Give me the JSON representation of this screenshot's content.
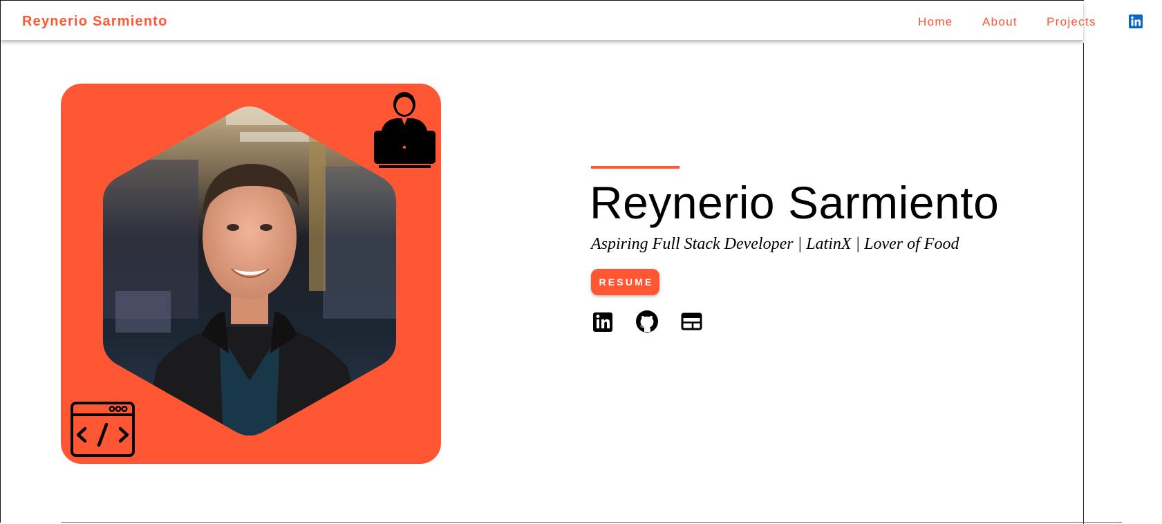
{
  "navbar": {
    "brand": "Reynerio Sarmiento",
    "links": [
      {
        "label": "Home"
      },
      {
        "label": "About"
      },
      {
        "label": "Projects"
      }
    ],
    "social_icon": "linkedin-icon"
  },
  "hero": {
    "name": "Reynerio Sarmiento",
    "tagline": "Aspiring Full Stack Developer | LatinX | Lover of Food",
    "resume_button": "RESUME",
    "social_links": [
      "linkedin-icon",
      "github-icon",
      "portfolio-window-icon"
    ],
    "decorative_icons": [
      "developer-laptop-icon",
      "code-window-icon"
    ]
  },
  "colors": {
    "accent": "#ff5733",
    "linkedin_blue": "#0a66c2",
    "text": "#000000",
    "background": "#ffffff"
  }
}
